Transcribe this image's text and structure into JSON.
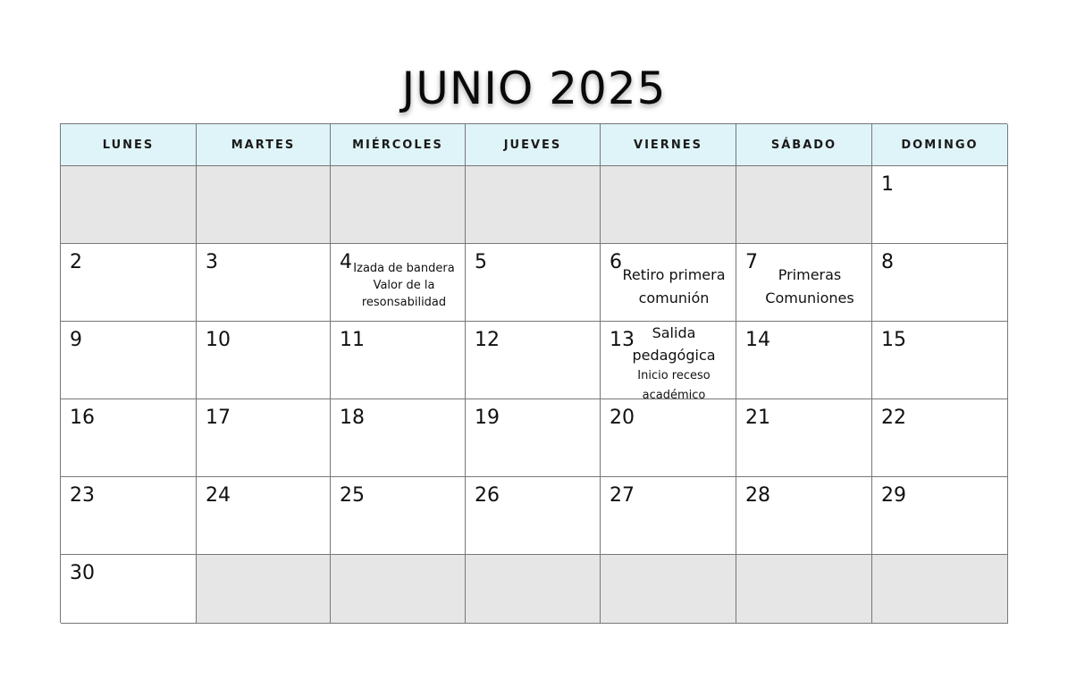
{
  "title": "JUNIO 2025",
  "weekdays": [
    "LUNES",
    "MARTES",
    "MIÉRCOLES",
    "JUEVES",
    "VIERNES",
    "SÁBADO",
    "DOMINGO"
  ],
  "colors": {
    "header_bg": "#dff4f8",
    "empty_bg": "#e6e6e6",
    "grid_line": "#777777"
  },
  "weeks": [
    [
      {
        "day": "",
        "empty": true
      },
      {
        "day": "",
        "empty": true
      },
      {
        "day": "",
        "empty": true
      },
      {
        "day": "",
        "empty": true
      },
      {
        "day": "",
        "empty": true
      },
      {
        "day": "",
        "empty": true
      },
      {
        "day": "1"
      }
    ],
    [
      {
        "day": "2"
      },
      {
        "day": "3"
      },
      {
        "day": "4",
        "events": [
          "Izada de bandera",
          "Valor de la",
          "resonsabilidad"
        ]
      },
      {
        "day": "5"
      },
      {
        "day": "6",
        "events": [
          "Retiro primera",
          "comunión"
        ]
      },
      {
        "day": "7",
        "events": [
          "Primeras",
          "Comuniones"
        ]
      },
      {
        "day": "8"
      }
    ],
    [
      {
        "day": "9"
      },
      {
        "day": "10"
      },
      {
        "day": "11"
      },
      {
        "day": "12"
      },
      {
        "day": "13",
        "events": [
          "Salida",
          "pedagógica",
          "Inicio receso",
          "académico"
        ]
      },
      {
        "day": "14"
      },
      {
        "day": "15"
      }
    ],
    [
      {
        "day": "16"
      },
      {
        "day": "17"
      },
      {
        "day": "18"
      },
      {
        "day": "19"
      },
      {
        "day": "20"
      },
      {
        "day": "21"
      },
      {
        "day": "22"
      }
    ],
    [
      {
        "day": "23"
      },
      {
        "day": "24"
      },
      {
        "day": "25"
      },
      {
        "day": "26"
      },
      {
        "day": "27"
      },
      {
        "day": "28"
      },
      {
        "day": "29"
      }
    ],
    [
      {
        "day": "30"
      },
      {
        "day": "",
        "empty": true
      },
      {
        "day": "",
        "empty": true
      },
      {
        "day": "",
        "empty": true
      },
      {
        "day": "",
        "empty": true
      },
      {
        "day": "",
        "empty": true
      },
      {
        "day": "",
        "empty": true
      }
    ]
  ]
}
